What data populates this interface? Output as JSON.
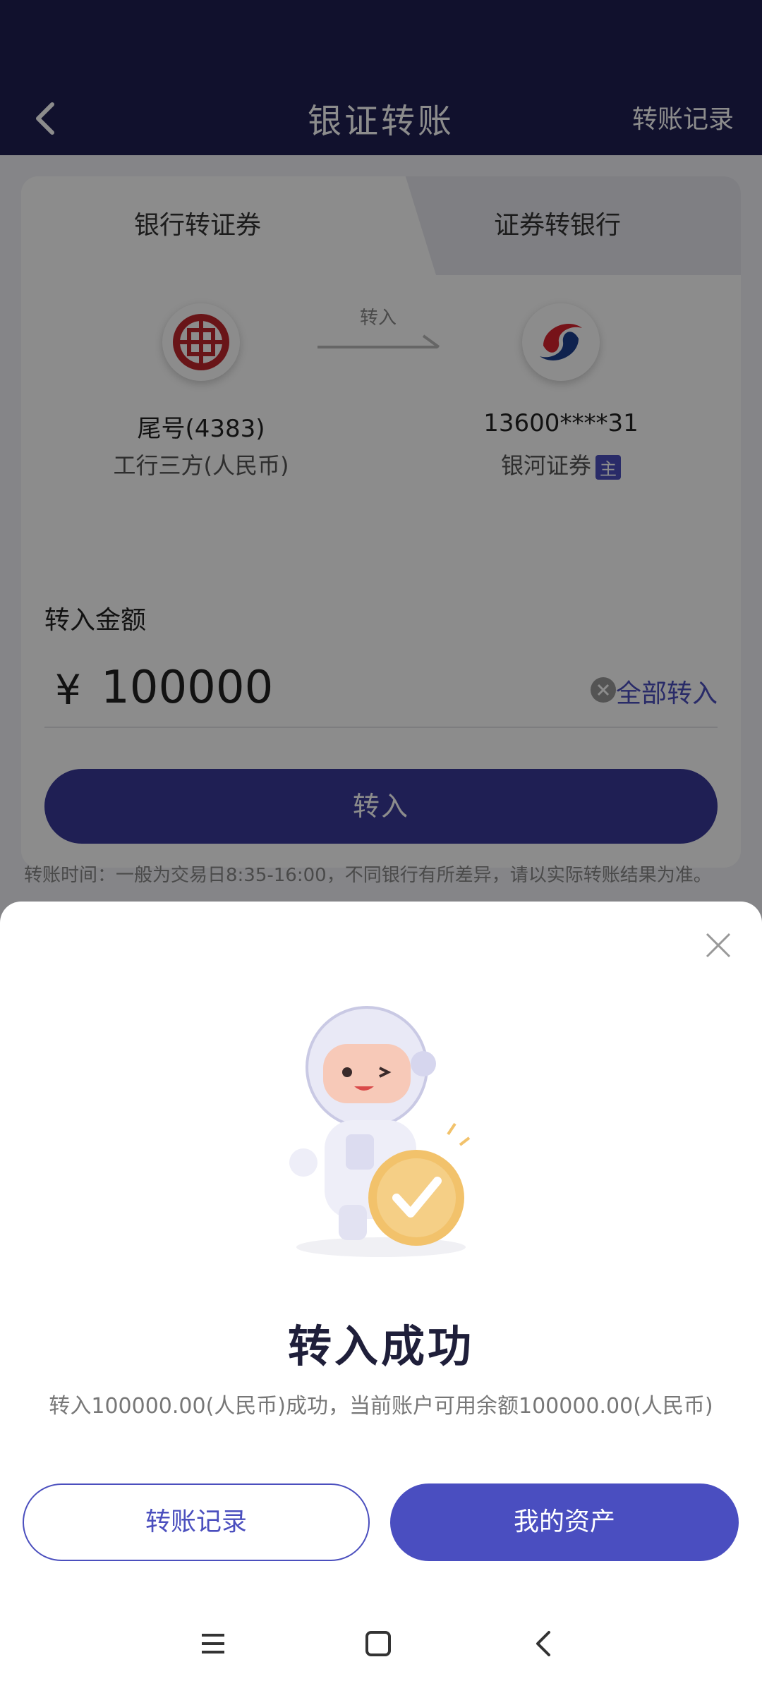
{
  "header": {
    "title": "银证转账",
    "record_link": "转账记录"
  },
  "tabs": {
    "bank_to_securities": "银行转证券",
    "securities_to_bank": "证券转银行"
  },
  "flow": {
    "direction_label": "转入",
    "bank": {
      "tail_number": "尾号(4383)",
      "name": "工行三方(人民币)"
    },
    "broker": {
      "account": "13600****31",
      "name": "银河证券",
      "badge": "主"
    }
  },
  "amount": {
    "label": "转入金额",
    "currency_symbol": "¥",
    "value": "100000",
    "all_in": "全部转入"
  },
  "submit_label": "转入",
  "note": "转账时间：一般为交易日8:35-16:00，不同银行有所差异，请以实际转账结果为准。",
  "modal": {
    "title": "转入成功",
    "description": "转入100000.00(人民币)成功，当前账户可用余额100000.00(人民币)",
    "history_button": "转账记录",
    "assets_button": "我的资产"
  },
  "colors": {
    "brand_dark": "#1f1f52",
    "accent": "#4a4ec0",
    "bank_red": "#c0272d",
    "broker_red": "#d9232e",
    "broker_blue": "#1d3f8f"
  },
  "icons": [
    "back-icon",
    "icbc-logo-icon",
    "arrow-right-icon",
    "galaxy-securities-logo-icon",
    "clear-icon",
    "close-icon",
    "mascot-icon",
    "menu-icon",
    "home-icon",
    "nav-back-icon"
  ]
}
